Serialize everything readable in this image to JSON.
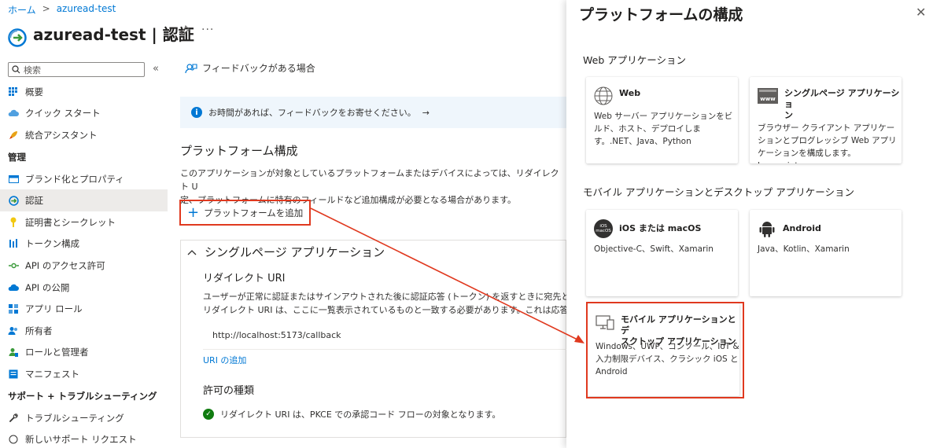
{
  "breadcrumb": {
    "home": "ホーム",
    "sep": ">",
    "current": "azuread-test"
  },
  "page": {
    "title": "azuread-test | 認証"
  },
  "icons": {
    "pin": "pin-icon",
    "more": "more-icon",
    "collapse": "collapse-icon"
  },
  "search": {
    "placeholder": "検索"
  },
  "sidebar": {
    "items_top": [
      {
        "label": "概要",
        "icon": "grid-icon"
      },
      {
        "label": "クイック スタート",
        "icon": "cloud-icon"
      },
      {
        "label": "統合アシスタント",
        "icon": "rocket-icon"
      }
    ],
    "section_manage": "管理",
    "items_manage": [
      {
        "label": "ブランド化とプロパティ",
        "icon": "branding-icon"
      },
      {
        "label": "認証",
        "icon": "auth-icon",
        "active": true
      },
      {
        "label": "証明書とシークレット",
        "icon": "key-icon"
      },
      {
        "label": "トークン構成",
        "icon": "bars-icon"
      },
      {
        "label": "API のアクセス許可",
        "icon": "api-icon"
      },
      {
        "label": "API の公開",
        "icon": "cloud-api-icon"
      },
      {
        "label": "アプリ ロール",
        "icon": "apps-icon"
      },
      {
        "label": "所有者",
        "icon": "users-icon"
      },
      {
        "label": "ロールと管理者",
        "icon": "role-icon"
      },
      {
        "label": "マニフェスト",
        "icon": "manifest-icon"
      }
    ],
    "section_support": "サポート + トラブルシューティング",
    "items_support": [
      {
        "label": "トラブルシューティング",
        "icon": "wrench-icon"
      },
      {
        "label": "新しいサポート リクエスト",
        "icon": "support-icon"
      }
    ]
  },
  "main": {
    "feedback_label": "フィードバックがある場合",
    "info_text": "お時間があれば、フィードバックをお寄せください。",
    "info_arrow": "→",
    "section_title": "プラットフォーム構成",
    "description_line1": "このアプリケーションが対象としているプラットフォームまたはデバイスによっては、リダイレクト U",
    "description_line2": "定、プラットフォームに特有のフィールドなど追加構成が必要となる場合があります。",
    "add_platform_label": "プラットフォームを追加",
    "spa_title": "シングルページ アプリケーション",
    "redirect_title": "リダイレクト URI",
    "redirect_desc_line1": "ユーザーが正常に認証またはサインアウトされた後に認証応答 (トークン) を返すときに宛先とし",
    "redirect_desc_line2": "リダイレクト URI は、ここに一覧表示されているものと一致する必要があります。これは応答 UR",
    "redirect_uri": "http://localhost:5173/callback",
    "add_uri_label": "URI の追加",
    "grant_title": "許可の種類",
    "grant_text": "リダイレクト URI は、PKCE での承認コード フローの対象となります。"
  },
  "panel": {
    "title": "プラットフォームの構成",
    "close": "✕",
    "web_group": "Web アプリケーション",
    "mobile_group": "モバイル アプリケーションとデスクトップ アプリケーション",
    "web": {
      "title": "Web",
      "desc": [
        "Web サーバー アプリケーションをビ",
        "ルド、ホスト、デプロイしま",
        "す。.NET、Java、Python"
      ]
    },
    "spa": {
      "title_line1": "シングルページ アプリケーショ",
      "title_line2": "ン",
      "icon_text": "www",
      "desc": [
        "ブラウザー クライアント アプリケー",
        "ションとプログレッシブ Web アプリ",
        "ケーションを構成します。Javascript、"
      ]
    },
    "ios": {
      "title": "iOS または macOS",
      "icon_text_1": "iOS",
      "icon_text_2": "macOS",
      "desc": [
        "Objective-C、Swift、Xamarin"
      ]
    },
    "android": {
      "title": "Android",
      "desc": [
        "Java、Kotlin、Xamarin"
      ]
    },
    "desktop": {
      "title_line1": "モバイル アプリケーションとデ",
      "title_line2": "スクトップ アプリケーション",
      "desc": [
        "Windows、UWP、コンソール、IoT &",
        "入力制限デバイス、クラシック iOS と",
        "Android"
      ]
    }
  }
}
